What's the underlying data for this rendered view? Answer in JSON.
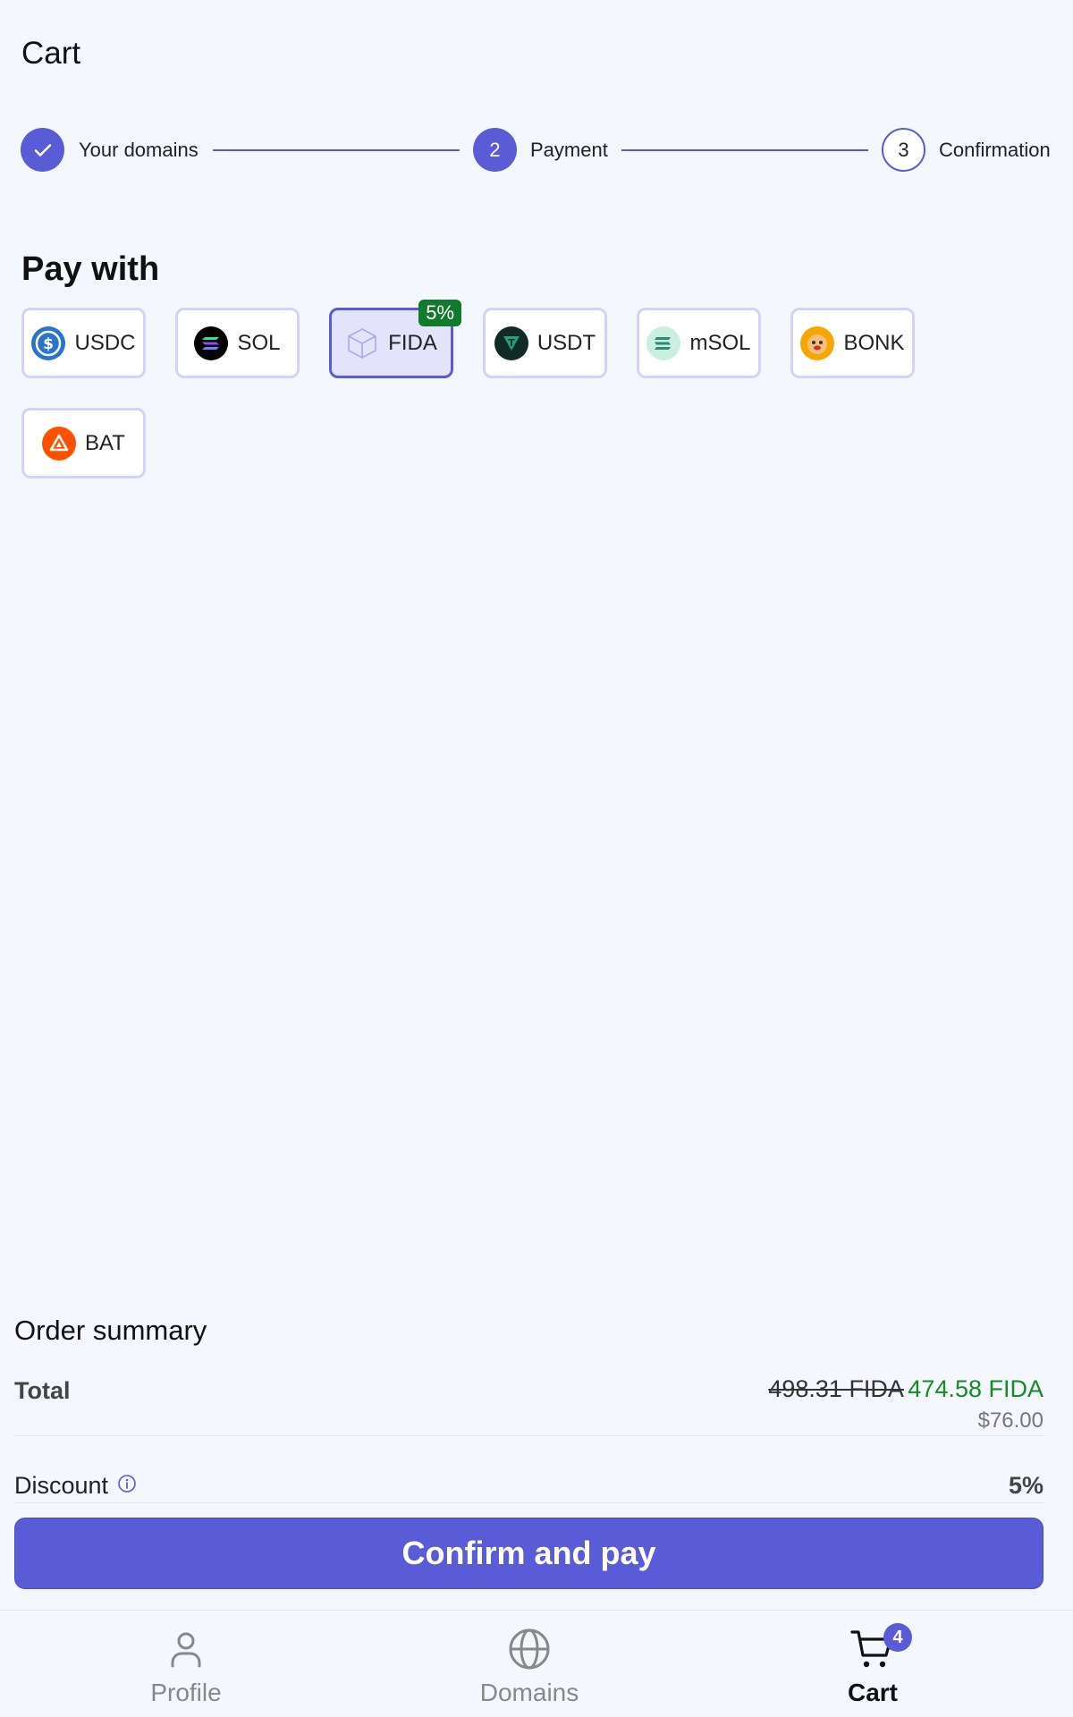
{
  "header": {
    "title": "Cart"
  },
  "stepper": {
    "steps": [
      {
        "label": "Your domains",
        "number": ""
      },
      {
        "label": "Payment",
        "number": "2"
      },
      {
        "label": "Confirmation",
        "number": "3"
      }
    ]
  },
  "payment": {
    "title": "Pay with",
    "tokens": [
      {
        "label": "USDC",
        "icon": "usdc-icon",
        "color": "#2775ca"
      },
      {
        "label": "SOL",
        "icon": "sol-icon",
        "color": "#000000"
      },
      {
        "label": "FIDA",
        "icon": "fida-icon",
        "color": "#a9a9f0",
        "badge": "5%",
        "selected": true
      },
      {
        "label": "USDT",
        "icon": "usdt-icon",
        "color": "#26a17b"
      },
      {
        "label": "mSOL",
        "icon": "msol-icon",
        "color": "#c9efe0"
      },
      {
        "label": "BONK",
        "icon": "bonk-icon",
        "color": "#f7a600"
      },
      {
        "label": "BAT",
        "icon": "bat-icon",
        "color": "#ff5000"
      }
    ]
  },
  "summary": {
    "title": "Order summary",
    "total_label": "Total",
    "old_price": "498.31 FIDA",
    "new_price": "474.58 FIDA",
    "usd_price": "$76.00",
    "discount_label": "Discount",
    "discount_value": "5%"
  },
  "actions": {
    "confirm_label": "Confirm and pay"
  },
  "nav": {
    "items": [
      {
        "label": "Profile",
        "icon": "profile-icon"
      },
      {
        "label": "Domains",
        "icon": "globe-icon"
      },
      {
        "label": "Cart",
        "icon": "cart-icon",
        "badge": "4",
        "active": true
      }
    ]
  },
  "colors": {
    "accent": "#5a5bd6",
    "success": "#168a28",
    "badge": "#117a2c"
  }
}
